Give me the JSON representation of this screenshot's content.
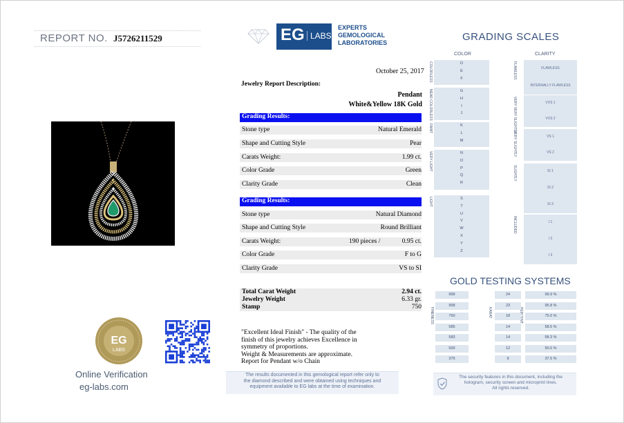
{
  "report": {
    "label": "REPORT NO.",
    "number": "J5726211529"
  },
  "logo": {
    "eg": "EG",
    "labs": "LABS",
    "line1": "EXPERTS",
    "line2": "GEMOLOGICAL",
    "line3": "LABORATORIES"
  },
  "date": "October 25, 2017",
  "description": {
    "label": "Jewelry Report Description:",
    "item": "Pendant",
    "metal": "White&Yellow 18K Gold"
  },
  "emerald": {
    "header": "Grading Results:",
    "rows": [
      {
        "k": "Stone type",
        "v": "Natural Emerald"
      },
      {
        "k": "Shape and Cutting Style",
        "v": "Pear"
      },
      {
        "k": "Carats Weight:",
        "v": "1.99  ct."
      },
      {
        "k": "Color Grade",
        "v": "Green"
      },
      {
        "k": "Clarity Grade",
        "v": "Clean"
      }
    ]
  },
  "diamond": {
    "header": "Grading Results:",
    "rows": [
      {
        "k": "Stone type",
        "v": "Natural Diamond"
      },
      {
        "k": "Shape and Cutting Style",
        "v": "Round Brilliant"
      },
      {
        "k": "Carats Weight:",
        "m": "190 pieces /",
        "v": "0.95  ct."
      },
      {
        "k": "Color Grade",
        "v": "F to G"
      },
      {
        "k": "Clarity Grade",
        "v": "VS to SI"
      }
    ]
  },
  "totals": [
    {
      "k": "Total Carat Weight",
      "v": "2.94  ct."
    },
    {
      "k": "Jewelry Weight",
      "v": "6.33  gr."
    },
    {
      "k": "Stamp",
      "v": "750"
    }
  ],
  "note": {
    "l1": "\"Excellent Ideal Finish\" - The quality of the",
    "l2": "finish of this jewelry achieves Excellence in",
    "l3": "symmetry of proportions.",
    "l4": "Weight & Measurements are approximate.",
    "l5": "Report for Pendant w/o Chain"
  },
  "disclaimer": {
    "l1": "The results documented in this gemological report refer only to",
    "l2": "the diamond described and were obtained using techniques and",
    "l3": "equipment available to EG labs at the time of examination."
  },
  "grading_scales": {
    "title": "GRADING SCALES",
    "color_header": "COLOR",
    "clarity_header": "CLARITY",
    "color_groups": [
      "COLORLESS",
      "NEAR COLORLESS",
      "FAINT",
      "VERY LIGHT",
      "LIGHT"
    ],
    "colors": [
      "D",
      "E",
      "F",
      "G",
      "H",
      "I",
      "J",
      "K",
      "L",
      "M",
      "N",
      "O",
      "P",
      "Q",
      "R",
      "S",
      "T",
      "U",
      "V",
      "W",
      "X",
      "Y",
      "Z"
    ],
    "clarity_groups": [
      "FLAWLESS",
      "VERY VERY SLIGHTLY",
      "VERY SLIGHTLY",
      "SLIGHTLY",
      "INCLUDED"
    ],
    "clarity": [
      "FLAWLESS",
      "INTERNALLY FLAWLESS",
      "VVS 1",
      "VVS 2",
      "VS 1",
      "VS 2",
      "SI 1",
      "SI 2",
      "SI 3",
      "I 1",
      "I 2",
      "I 3"
    ]
  },
  "gold": {
    "title": "GOLD TESTING SYSTEMS",
    "fineness": [
      "999",
      "958",
      "750",
      "585",
      "583",
      "500",
      "375"
    ],
    "karat": [
      "24",
      "23",
      "18",
      "14",
      "14",
      "12",
      "9"
    ],
    "percent": [
      "99.9 %",
      "95.8 %",
      "75.0 %",
      "58.5 %",
      "58.3 %",
      "50.0 %",
      "37.5 %"
    ],
    "col1_label": "FINENESS",
    "col2_label": "KARAT",
    "col3_label": "PERCENT"
  },
  "security": {
    "l1": "The security features in this document, including the",
    "l2": "hologram, security screen and microprint lines.",
    "l3": "All rights reserved."
  },
  "verify": {
    "line1": "Online Verification",
    "line2": "eg-labs.com",
    "seal_eg": "EG",
    "seal_labs": "LABS"
  },
  "colors": {
    "brand": "#1c4e8c",
    "band": "#0a10f0",
    "scale_box": "#dee6ef"
  }
}
